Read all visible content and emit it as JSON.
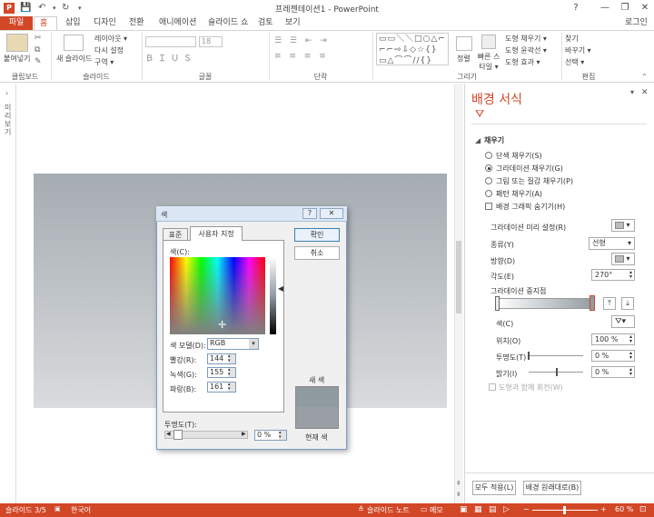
{
  "window": {
    "title": "프레젠테이션1 - PowerPoint",
    "app_icon": "P",
    "minimize": "—",
    "restore": "❐",
    "close": "✕",
    "help": "?"
  },
  "qat": {
    "save": "💾",
    "undo": "↶",
    "redo": "↻",
    "customize": "▾"
  },
  "tabs": [
    "파일",
    "홈",
    "삽입",
    "디자인",
    "전환",
    "애니메이션",
    "슬라이드 쇼",
    "검토",
    "보기"
  ],
  "signin": "로그인",
  "ribbon": {
    "groups": [
      "클립보드",
      "슬라이드",
      "글꼴",
      "단락",
      "그리기",
      "편집"
    ],
    "paste": "붙여넣기",
    "new_slide": "새 슬라이드",
    "layout": "레이아웃 ▾",
    "reset": "다시 설정",
    "section": "구역 ▾",
    "font_size": "18",
    "arrange": "정렬",
    "quick_styles": "빠른 스타일 ▾",
    "shape_fill": "도형 채우기 ▾",
    "shape_outline": "도형 윤곽선 ▾",
    "shape_effects": "도형 효과 ▾",
    "find": "찾기",
    "replace": "바꾸기 ▾",
    "select": "선택 ▾"
  },
  "left_strip": {
    "label": "미리보기"
  },
  "format_pane": {
    "title": "배경 서식",
    "section": "채우기",
    "options": [
      "단색 채우기(S)",
      "그라데이션 채우기(G)",
      "그림 또는 질감 채우기(P)",
      "패턴 채우기(A)"
    ],
    "hide_graphics": "배경 그래픽 숨기기(H)",
    "preset": "그라데이션 미리 설정(R)",
    "type_label": "종류(Y)",
    "type_value": "선형",
    "direction_label": "방향(D)",
    "angle_label": "각도(E)",
    "angle_value": "270°",
    "stops_label": "그라데이션 중지점",
    "color_label": "색(C)",
    "position_label": "위치(O)",
    "position_value": "100 %",
    "transparency_label": "투명도(T)",
    "transparency_value": "0 %",
    "brightness_label": "밝기(I)",
    "brightness_value": "0 %",
    "rotate_with_shape": "도형과 함께 회전(W)",
    "apply_all": "모두 적용(L)",
    "reset_background": "배경 원래대로(B)"
  },
  "dialog": {
    "title": "색",
    "help": "?",
    "close": "✕",
    "tab_standard": "표준",
    "tab_custom": "사용자 지정",
    "colors_label": "색(C):",
    "model_label": "색 모델(D):",
    "model_value": "RGB",
    "red_label": "빨강(R):",
    "red_value": "144",
    "green_label": "녹색(G):",
    "green_value": "155",
    "blue_label": "파랑(B):",
    "blue_value": "161",
    "transparency_label": "투명도(T):",
    "transparency_value": "0 %",
    "ok": "확인",
    "cancel": "취소",
    "new_label": "새 색",
    "current_label": "현재 색",
    "new_color": "#909ba1"
  },
  "status": {
    "slide": "슬라이드 3/5",
    "language": "한국어",
    "notes": "슬라이드 노트",
    "comments": "메모",
    "zoom": "60 %"
  },
  "colors": {
    "accent": "#d24726",
    "slide_top": "#a5acb2",
    "slide_bottom": "#d9dbdd"
  }
}
